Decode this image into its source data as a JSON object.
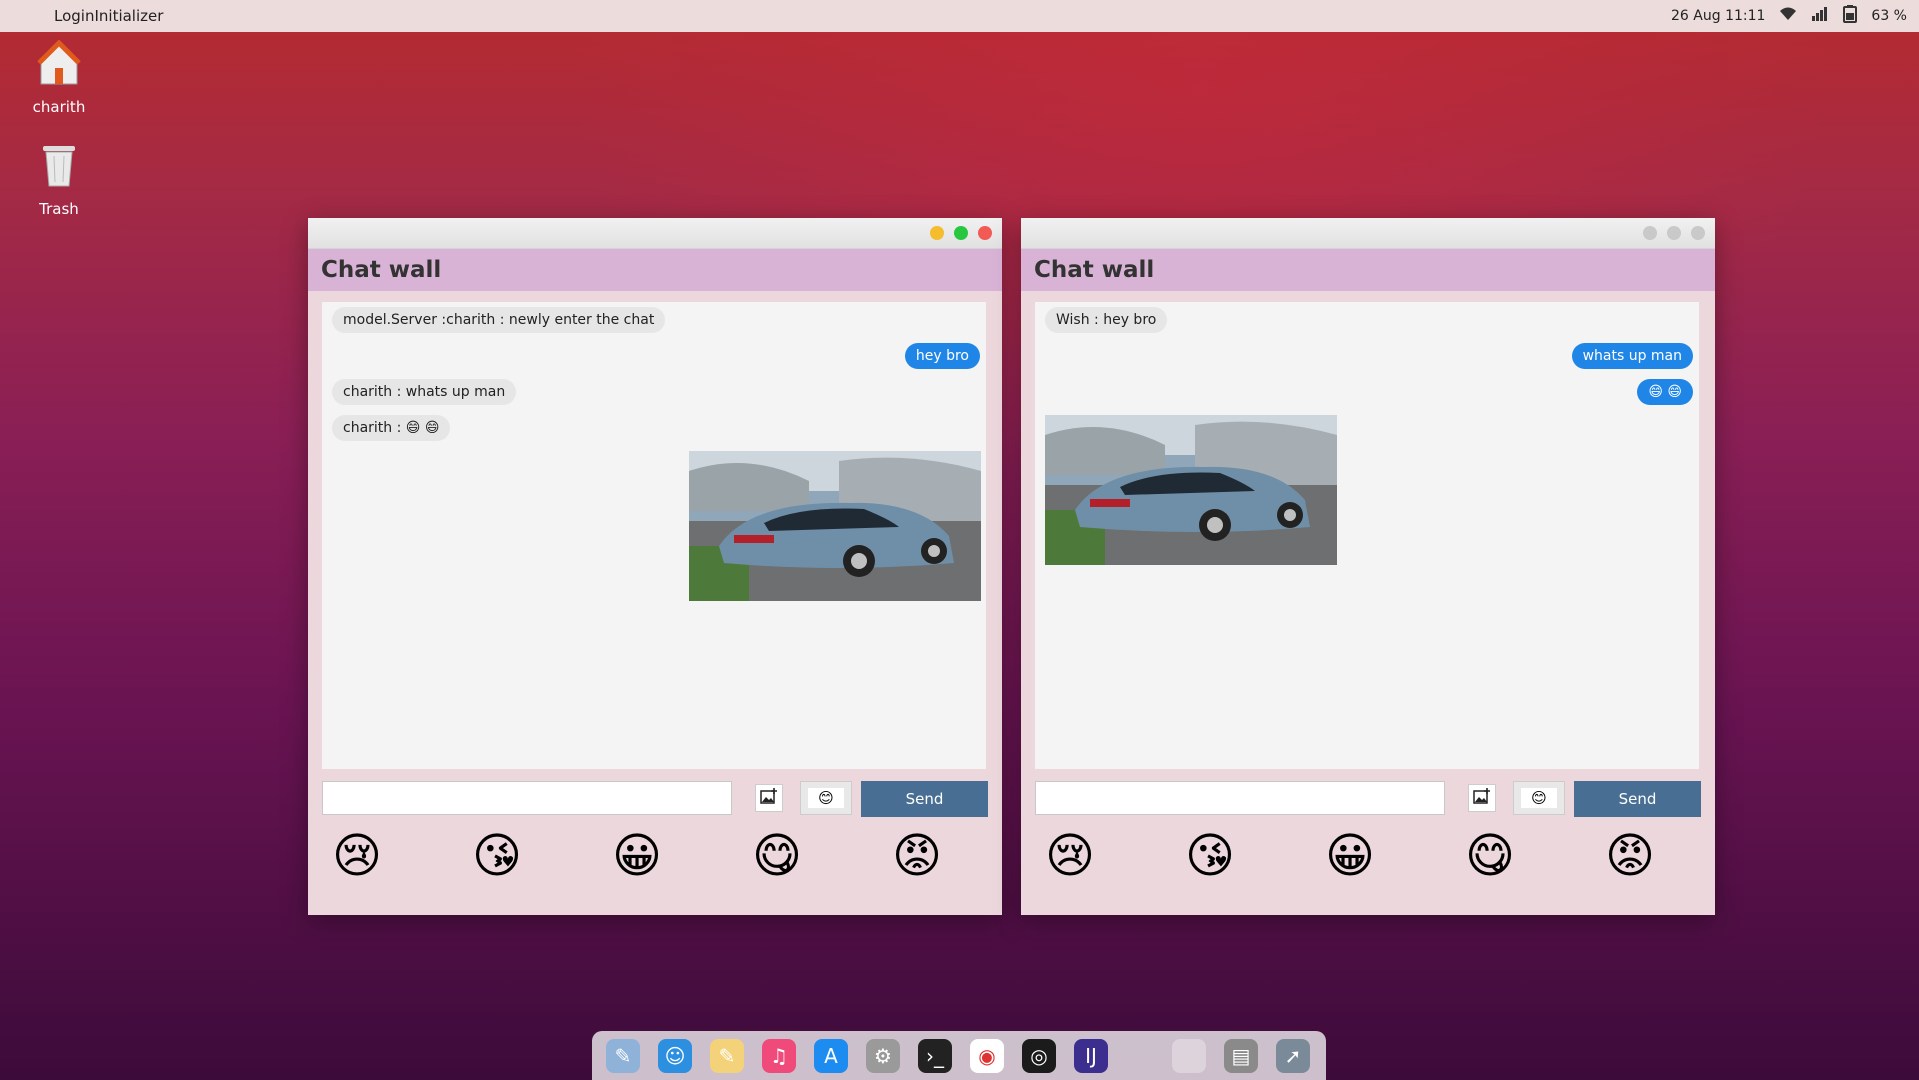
{
  "topbar": {
    "apple_icon": "apple-logo-icon",
    "app_name": "LoginInitializer",
    "datetime": "26 Aug  11:11",
    "battery": "63 %"
  },
  "desktop": {
    "icons": [
      {
        "label": "charith",
        "icon": "home-folder-icon"
      },
      {
        "label": "Trash",
        "icon": "trash-icon"
      }
    ]
  },
  "windows": [
    {
      "title": "Chat wall",
      "messages": [
        {
          "kind": "in",
          "text": "model.Server :charith : newly enter the chat"
        },
        {
          "kind": "out",
          "text": "hey bro"
        },
        {
          "kind": "in",
          "text": "charith : whats up man"
        },
        {
          "kind": "in",
          "text": "charith :  😄 😄"
        }
      ],
      "input_value": "",
      "emoji_button": "😊",
      "send_label": "Send"
    },
    {
      "title": "Chat wall",
      "messages": [
        {
          "kind": "in",
          "text": "Wish : hey bro"
        },
        {
          "kind": "out",
          "text": "whats up man"
        },
        {
          "kind": "out",
          "text": "😄 😄"
        }
      ],
      "input_value": "",
      "emoji_button": "😊",
      "send_label": "Send"
    }
  ],
  "emoji_bar": [
    "😢",
    "😘",
    "😀",
    "😋",
    "😡"
  ],
  "colors": {
    "header": "#d9b3d6",
    "send_button": "#486f93",
    "outgoing_bubble": "#1f86e8",
    "incoming_bubble": "#e6e6e6",
    "close": "#f25b55",
    "minimize": "#f5bd2e",
    "maximize": "#27c840"
  },
  "dock": {
    "items": [
      "preview-icon",
      "finder-icon",
      "notes-icon",
      "music-icon",
      "app-store-icon",
      "settings-icon",
      "terminal-icon",
      "chrome-icon",
      "obs-icon",
      "intellij-icon",
      "empty-slot",
      "printer-icon",
      "launchpad-icon"
    ]
  }
}
